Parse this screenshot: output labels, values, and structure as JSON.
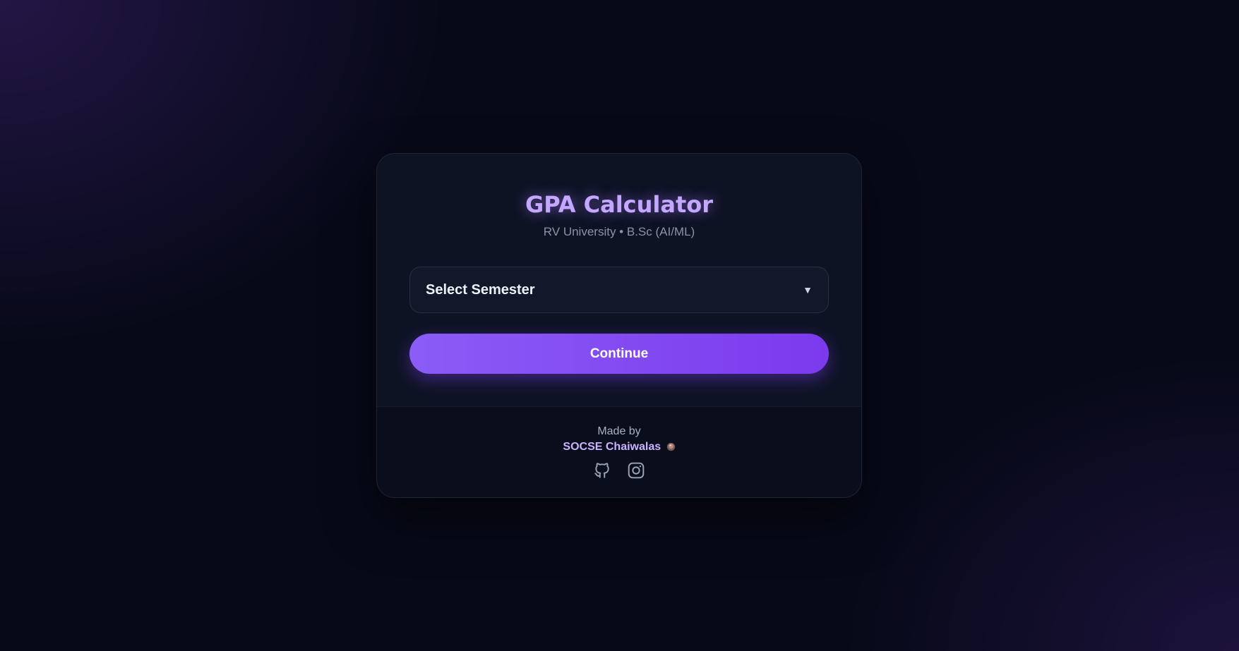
{
  "app": {
    "title": "GPA Calculator",
    "subtitle": "RV University • B.Sc (AI/ML)"
  },
  "semester_select": {
    "selected": "Select Semester",
    "arrow_icon": "triangle-down-icon"
  },
  "continue_button": {
    "label": "Continue"
  },
  "footer": {
    "made_by": "Made by",
    "author": "SOCSE Chaiwalas",
    "author_icon": "tea-cup-icon",
    "social_icons": [
      "github-icon",
      "instagram-icon"
    ]
  },
  "colors": {
    "background": "#070918",
    "card": "#0e1324",
    "footer": "#0a0e1c",
    "title": "#c4a8ff",
    "accent": "#8b5cf6",
    "accent_dark": "#7c3aed",
    "author": "#c9b2ff"
  }
}
